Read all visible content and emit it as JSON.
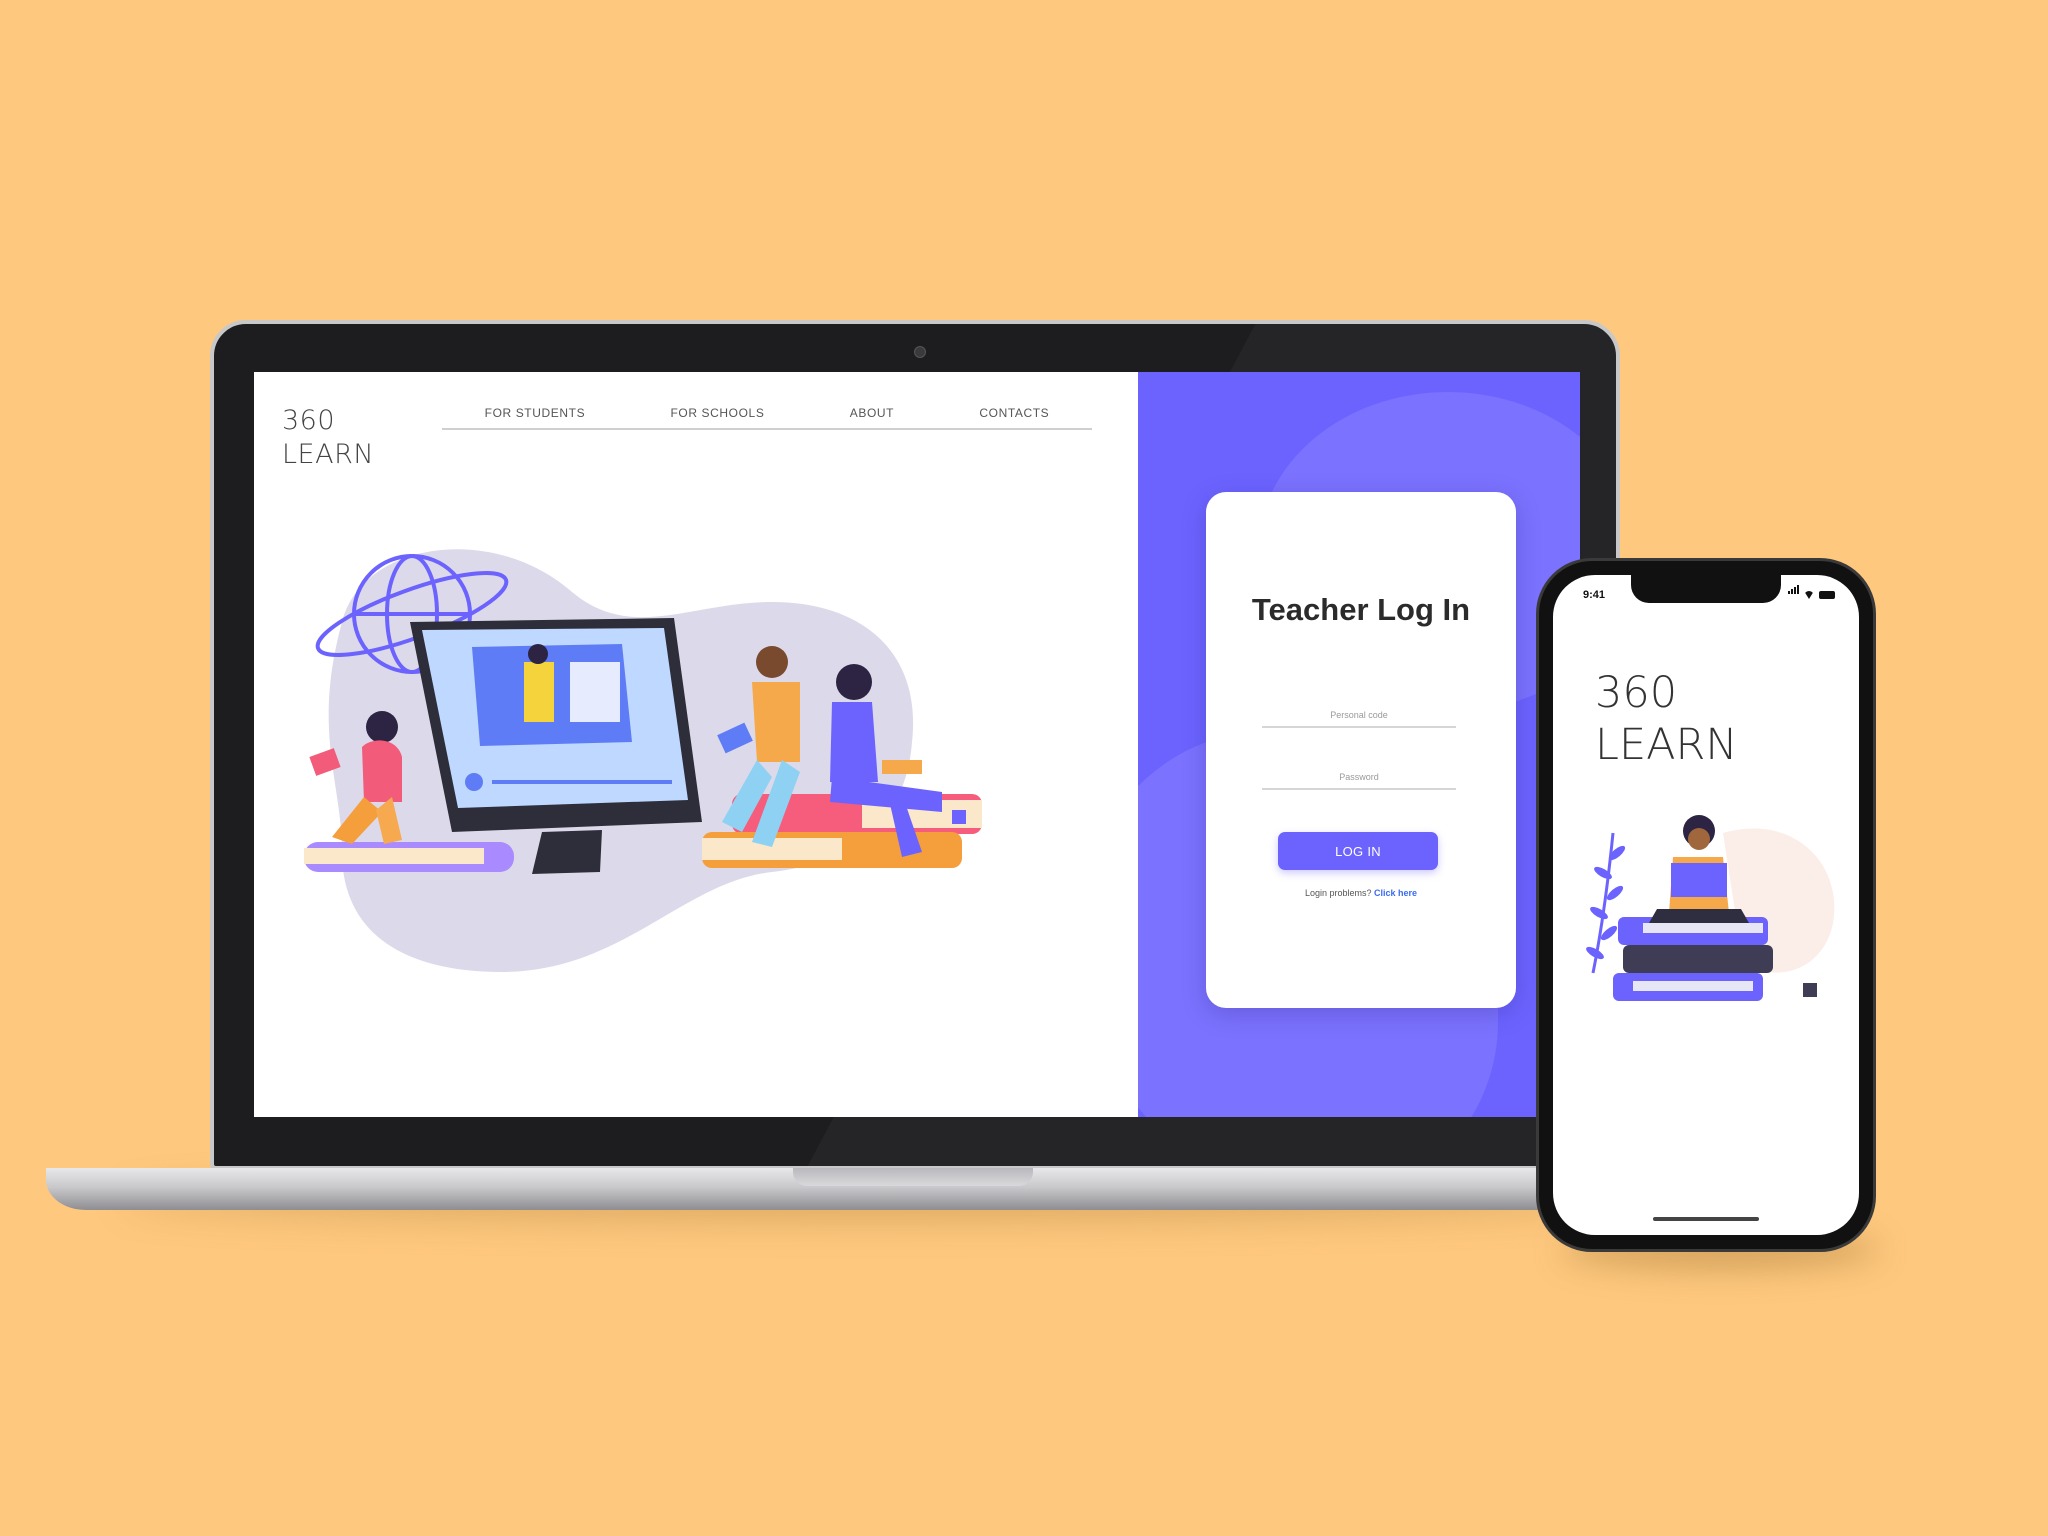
{
  "colors": {
    "background": "#FEC87E",
    "accent": "#6C63FF",
    "link": "#3B6CF0"
  },
  "desktop": {
    "brand_line1": "360",
    "brand_line2": "LEARN",
    "nav": {
      "items": [
        "FOR STUDENTS",
        "FOR SCHOOLS",
        "ABOUT",
        "CONTACTS"
      ]
    },
    "login": {
      "title": "Teacher Log In",
      "personal_code_placeholder": "Personal code",
      "password_placeholder": "Password",
      "button_label": "LOG IN",
      "help_text": "Login problems?",
      "help_link": "Click here"
    }
  },
  "mobile": {
    "status_time": "9:41",
    "brand_line1": "360",
    "brand_line2": "LEARN"
  },
  "icons": {
    "camera": "camera-icon",
    "globe": "globe-icon",
    "play": "play-icon",
    "bookmark": "bookmark-icon",
    "signal": "signal-icon",
    "wifi": "wifi-icon",
    "battery": "battery-icon"
  }
}
